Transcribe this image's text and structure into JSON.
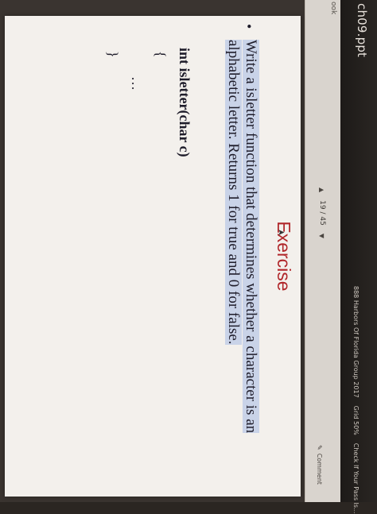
{
  "browser": {
    "file_name": "ch09.ppt",
    "bookmarks": [
      "888 Harbors Of Florida Group 2017",
      "Grid 50%",
      "Check If Your Pass Is..."
    ]
  },
  "toolbar": {
    "left_label": "ook",
    "page_current": "19",
    "page_total": "45",
    "page_indicator": "19 / 45",
    "comment_label": "Comment"
  },
  "slide": {
    "title": "Exercise",
    "bullet_text": "Write a isletter function that determines whether a character is an alphabetic letter. Returns 1 for true and 0 for false.",
    "code": {
      "signature": "int isletter(char c)",
      "open_brace": "{",
      "ellipsis": "…",
      "close_brace": "}"
    }
  },
  "colors": {
    "title": "#b0262a",
    "highlight": "#c9d3e8",
    "slide_bg": "#f3f0ec"
  }
}
